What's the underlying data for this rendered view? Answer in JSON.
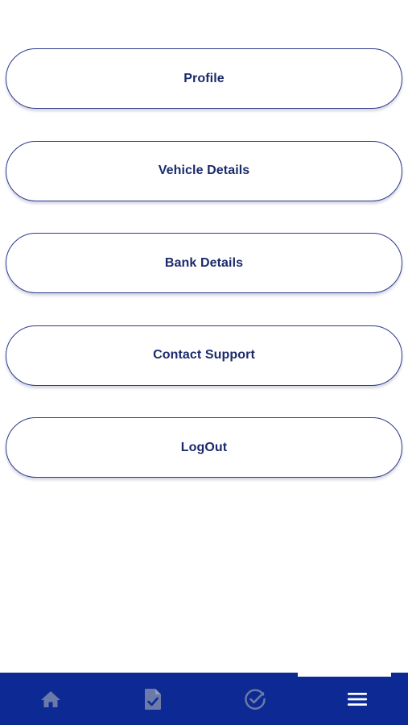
{
  "menu": {
    "items": [
      {
        "label": "Profile"
      },
      {
        "label": "Vehicle Details"
      },
      {
        "label": "Bank Details"
      },
      {
        "label": "Contact Support"
      },
      {
        "label": "LogOut"
      }
    ]
  },
  "bottom_nav": {
    "items": [
      {
        "icon": "home-icon",
        "active": false
      },
      {
        "icon": "document-check-icon",
        "active": false
      },
      {
        "icon": "check-circle-icon",
        "active": false
      },
      {
        "icon": "menu-icon",
        "active": true
      }
    ]
  },
  "colors": {
    "nav_background": "#0d2a94",
    "button_border": "#2d3a8c",
    "button_text": "#1b2a6b",
    "inactive_icon": "#6b7aa8",
    "active_icon": "#ffffff"
  }
}
